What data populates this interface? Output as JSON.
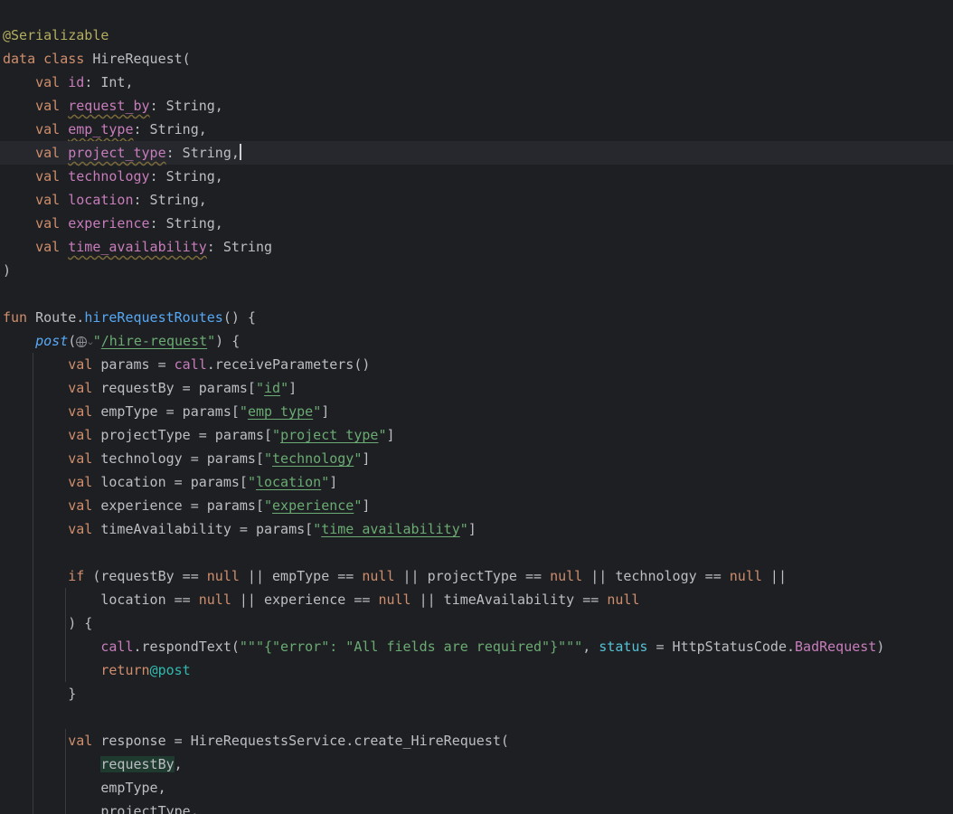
{
  "editor": {
    "lines": [
      {
        "tokens": [
          {
            "t": "@Serializable",
            "c": "ann"
          }
        ]
      },
      {
        "tokens": [
          {
            "t": "data class ",
            "c": "kw"
          },
          {
            "t": "HireRequest("
          }
        ]
      },
      {
        "tokens": [
          {
            "t": "    val ",
            "c": "kw"
          },
          {
            "t": "id",
            "c": "prop"
          },
          {
            "t": ": Int,"
          }
        ]
      },
      {
        "tokens": [
          {
            "t": "    val ",
            "c": "kw"
          },
          {
            "t": "request_by",
            "c": "prop sq"
          },
          {
            "t": ": String,"
          }
        ]
      },
      {
        "tokens": [
          {
            "t": "    val ",
            "c": "kw"
          },
          {
            "t": "emp_type",
            "c": "prop sq"
          },
          {
            "t": ": String,"
          }
        ]
      },
      {
        "current": true,
        "tokens": [
          {
            "t": "    val ",
            "c": "kw"
          },
          {
            "t": "project_type",
            "c": "prop sq"
          },
          {
            "t": ": String,"
          },
          {
            "caret": true
          }
        ]
      },
      {
        "tokens": [
          {
            "t": "    val ",
            "c": "kw"
          },
          {
            "t": "technology",
            "c": "prop"
          },
          {
            "t": ": String,"
          }
        ]
      },
      {
        "tokens": [
          {
            "t": "    val ",
            "c": "kw"
          },
          {
            "t": "location",
            "c": "prop"
          },
          {
            "t": ": String,"
          }
        ]
      },
      {
        "tokens": [
          {
            "t": "    val ",
            "c": "kw"
          },
          {
            "t": "experience",
            "c": "prop"
          },
          {
            "t": ": String,"
          }
        ]
      },
      {
        "tokens": [
          {
            "t": "    val ",
            "c": "kw"
          },
          {
            "t": "time_availability",
            "c": "prop sq"
          },
          {
            "t": ": String"
          }
        ]
      },
      {
        "tokens": [
          {
            "t": ")"
          }
        ]
      },
      {
        "tokens": []
      },
      {
        "tokens": [
          {
            "t": "fun ",
            "c": "kw"
          },
          {
            "t": "Route."
          },
          {
            "t": "hireRequestRoutes",
            "c": "fn"
          },
          {
            "t": "() {"
          }
        ]
      },
      {
        "tokens": [
          {
            "t": "    "
          },
          {
            "t": "post",
            "c": "ifn"
          },
          {
            "t": "("
          },
          {
            "icon": "globe-icon"
          },
          {
            "icon": "chevron-down-icon"
          },
          {
            "t": "\"",
            "c": "str"
          },
          {
            "t": "/hire-request",
            "c": "strl"
          },
          {
            "t": "\"",
            "c": "str"
          },
          {
            "t": ") {"
          }
        ]
      },
      {
        "tokens": [
          {
            "t": "        val ",
            "c": "kw"
          },
          {
            "t": "params = "
          },
          {
            "t": "call",
            "c": "prop"
          },
          {
            "t": ".receiveParameters()"
          }
        ]
      },
      {
        "tokens": [
          {
            "t": "        val ",
            "c": "kw"
          },
          {
            "t": "requestBy = params["
          },
          {
            "t": "\"",
            "c": "str"
          },
          {
            "t": "id",
            "c": "strl"
          },
          {
            "t": "\"",
            "c": "str"
          },
          {
            "t": "]"
          }
        ]
      },
      {
        "tokens": [
          {
            "t": "        val ",
            "c": "kw"
          },
          {
            "t": "empType = params["
          },
          {
            "t": "\"",
            "c": "str"
          },
          {
            "t": "emp_type",
            "c": "strl"
          },
          {
            "t": "\"",
            "c": "str"
          },
          {
            "t": "]"
          }
        ]
      },
      {
        "tokens": [
          {
            "t": "        val ",
            "c": "kw"
          },
          {
            "t": "projectType = params["
          },
          {
            "t": "\"",
            "c": "str"
          },
          {
            "t": "project_type",
            "c": "strl"
          },
          {
            "t": "\"",
            "c": "str"
          },
          {
            "t": "]"
          }
        ]
      },
      {
        "tokens": [
          {
            "t": "        val ",
            "c": "kw"
          },
          {
            "t": "technology = params["
          },
          {
            "t": "\"",
            "c": "str"
          },
          {
            "t": "technology",
            "c": "strl"
          },
          {
            "t": "\"",
            "c": "str"
          },
          {
            "t": "]"
          }
        ]
      },
      {
        "tokens": [
          {
            "t": "        val ",
            "c": "kw"
          },
          {
            "t": "location = params["
          },
          {
            "t": "\"",
            "c": "str"
          },
          {
            "t": "location",
            "c": "strl"
          },
          {
            "t": "\"",
            "c": "str"
          },
          {
            "t": "]"
          }
        ]
      },
      {
        "tokens": [
          {
            "t": "        val ",
            "c": "kw"
          },
          {
            "t": "experience = params["
          },
          {
            "t": "\"",
            "c": "str"
          },
          {
            "t": "experience",
            "c": "strl"
          },
          {
            "t": "\"",
            "c": "str"
          },
          {
            "t": "]"
          }
        ]
      },
      {
        "tokens": [
          {
            "t": "        val ",
            "c": "kw"
          },
          {
            "t": "timeAvailability = params["
          },
          {
            "t": "\"",
            "c": "str"
          },
          {
            "t": "time_availability",
            "c": "strl"
          },
          {
            "t": "\"",
            "c": "str"
          },
          {
            "t": "]"
          }
        ]
      },
      {
        "tokens": []
      },
      {
        "tokens": [
          {
            "t": "        if ",
            "c": "kw"
          },
          {
            "t": "(requestBy == "
          },
          {
            "t": "null",
            "c": "kw"
          },
          {
            "t": " || empType == "
          },
          {
            "t": "null",
            "c": "kw"
          },
          {
            "t": " || projectType == "
          },
          {
            "t": "null",
            "c": "kw"
          },
          {
            "t": " || technology == "
          },
          {
            "t": "null",
            "c": "kw"
          },
          {
            "t": " ||"
          }
        ]
      },
      {
        "tokens": [
          {
            "t": "            location == "
          },
          {
            "t": "null",
            "c": "kw"
          },
          {
            "t": " || experience == "
          },
          {
            "t": "null",
            "c": "kw"
          },
          {
            "t": " || timeAvailability == "
          },
          {
            "t": "null",
            "c": "kw"
          }
        ]
      },
      {
        "tokens": [
          {
            "t": "        ) {"
          }
        ]
      },
      {
        "tokens": [
          {
            "t": "            "
          },
          {
            "t": "call",
            "c": "prop"
          },
          {
            "t": ".respondText("
          },
          {
            "t": "\"\"\"{\"error\": \"All fields are required\"}\"\"\"",
            "c": "str"
          },
          {
            "t": ", "
          },
          {
            "t": "status",
            "c": "named"
          },
          {
            "t": " = HttpStatusCode."
          },
          {
            "t": "BadRequest",
            "c": "prop"
          },
          {
            "t": ")"
          }
        ]
      },
      {
        "tokens": [
          {
            "t": "            return",
            "c": "kw"
          },
          {
            "t": "@post",
            "c": "lbl"
          }
        ]
      },
      {
        "tokens": [
          {
            "t": "        }"
          }
        ]
      },
      {
        "tokens": []
      },
      {
        "tokens": [
          {
            "t": "        val ",
            "c": "kw"
          },
          {
            "t": "response = HireRequestsService.create_HireRequest("
          }
        ]
      },
      {
        "tokens": [
          {
            "t": "            "
          },
          {
            "t": "requestBy",
            "c": "hl"
          },
          {
            "t": ","
          }
        ]
      },
      {
        "tokens": [
          {
            "t": "            empType,"
          }
        ]
      },
      {
        "tokens": [
          {
            "t": "            projectType,"
          }
        ]
      }
    ]
  },
  "colors": {
    "background": "#1e1f22",
    "current_line": "#26282e",
    "keyword": "#cf8e6d",
    "annotation": "#b3ae60",
    "property": "#c77dbb",
    "function": "#56a8f5",
    "string": "#6aab73",
    "named_argument": "#56c1d6",
    "label": "#32b8af",
    "text": "#bcbec4"
  }
}
